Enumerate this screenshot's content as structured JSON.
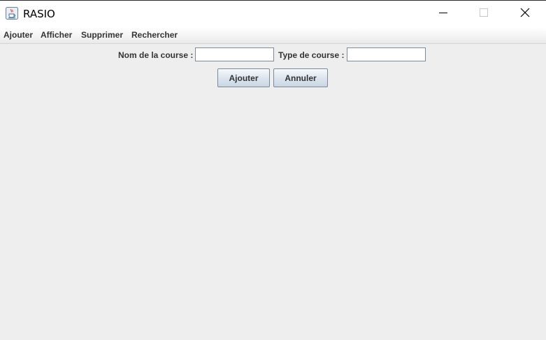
{
  "window": {
    "title": "RASIO",
    "app_icon": "java-cup-icon",
    "controls": {
      "minimize_icon": "minimize-icon",
      "maximize_icon": "maximize-icon",
      "close_icon": "close-icon"
    }
  },
  "menubar": {
    "items": [
      {
        "label": "Ajouter"
      },
      {
        "label": "Afficher"
      },
      {
        "label": "Supprimer"
      },
      {
        "label": "Rechercher"
      }
    ]
  },
  "form": {
    "course_name_label": "Nom de la course :",
    "course_name_value": "",
    "course_type_label": "Type de course :",
    "course_type_value": "",
    "add_button": "Ajouter",
    "cancel_button": "Annuler"
  },
  "colors": {
    "background": "#eeeeee",
    "titlebar": "#ffffff",
    "button_border": "#7a8a99",
    "text": "#333333"
  }
}
